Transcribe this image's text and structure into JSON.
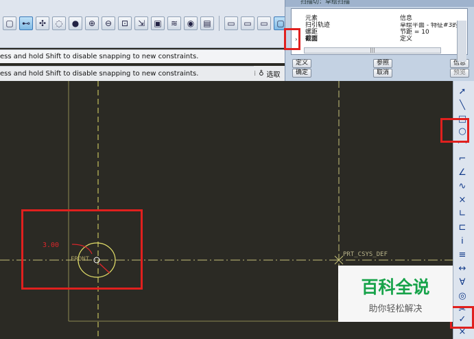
{
  "messages": {
    "line1": "ess and hold Shift to disable snapping to new constraints.",
    "line2": "ess and hold Shift to disable snapping to new constraints.",
    "select_label": "选取"
  },
  "dialog": {
    "title": "扫描切：草绘扫描",
    "col_element": "元素",
    "col_info": "信息",
    "rows": [
      {
        "element": "扫引轨迹",
        "info": "草绘平面 - 特征#3的"
      },
      {
        "element": "螺距",
        "info": "节距 = 10"
      },
      {
        "element": "截面",
        "info": "定义"
      }
    ],
    "scroll_mark": "|||",
    "buttons": {
      "define": "定义",
      "reference": "参照",
      "info": "信息",
      "ok": "确定",
      "cancel": "取消",
      "preview": "预览"
    }
  },
  "canvas": {
    "dimension": "3.00",
    "front_label": "FRONT",
    "csys_label": "PRT_CSYS_DEF"
  },
  "watermark": {
    "title": "百科全说",
    "subtitle": "助你轻松解决"
  },
  "colors": {
    "canvas_bg": "#2b2a24",
    "guide_yellow": "#e4e06a",
    "dimension_red": "#d9262b",
    "highlight_red": "#e0201e",
    "watermark_green": "#17a34a"
  }
}
